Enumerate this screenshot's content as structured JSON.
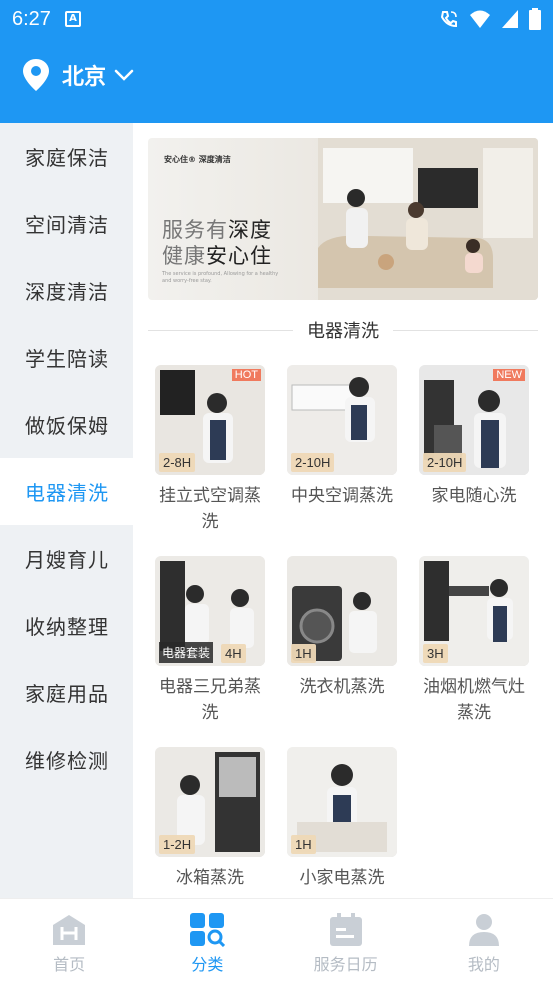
{
  "status_bar": {
    "time": "6:27",
    "notif_glyph": "A"
  },
  "header": {
    "city": "北京"
  },
  "sidebar": {
    "items": [
      {
        "label": "家庭保洁"
      },
      {
        "label": "空间清洁"
      },
      {
        "label": "深度清洁"
      },
      {
        "label": "学生陪读"
      },
      {
        "label": "做饭保姆"
      },
      {
        "label": "电器清洗",
        "active": true
      },
      {
        "label": "月嫂育儿"
      },
      {
        "label": "收纳整理"
      },
      {
        "label": "家庭用品"
      },
      {
        "label": "维修检测"
      }
    ]
  },
  "banner": {
    "brand": "安心住® 深度清洁",
    "line1_a": "服务有",
    "line1_b": "深度",
    "line2_a": "健康",
    "line2_b": "安心住",
    "sub": "The service is profound, Allowing for a healthy and worry-free stay."
  },
  "section": {
    "title": "电器清洗"
  },
  "services": [
    {
      "name": "挂立式空调蒸洗",
      "duration": "2-8H",
      "tag": "HOT"
    },
    {
      "name": "中央空调蒸洗",
      "duration": "2-10H"
    },
    {
      "name": "家电随心洗",
      "duration": "2-10H",
      "tag": "NEW"
    },
    {
      "name": "电器三兄弟蒸洗",
      "duration": "4H",
      "package": "电器套装"
    },
    {
      "name": "洗衣机蒸洗",
      "duration": "1H"
    },
    {
      "name": "油烟机燃气灶蒸洗",
      "duration": "3H"
    },
    {
      "name": "冰箱蒸洗",
      "duration": "1-2H"
    },
    {
      "name": "小家电蒸洗",
      "duration": "1H"
    }
  ],
  "tabbar": {
    "tabs": [
      {
        "label": "首页"
      },
      {
        "label": "分类",
        "active": true
      },
      {
        "label": "服务日历"
      },
      {
        "label": "我的"
      }
    ]
  },
  "colors": {
    "brand_blue": "#1e97f3",
    "tab_inactive": "#b5bcc4",
    "hot_tag": "#f07a5e"
  }
}
